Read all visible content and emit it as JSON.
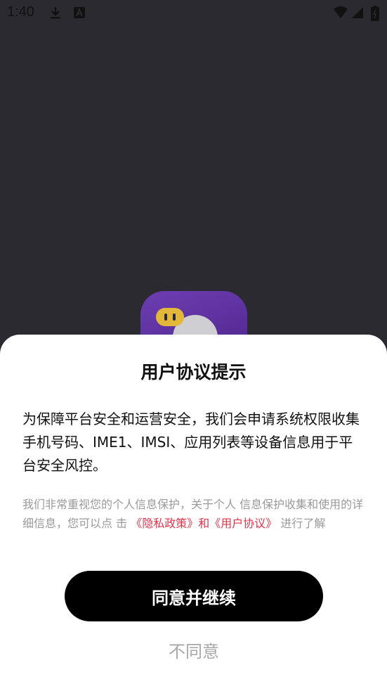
{
  "status_bar": {
    "time": "1:40",
    "icons": [
      "download-icon",
      "a-icon",
      "wifi-icon",
      "signal-icon",
      "battery-icon"
    ]
  },
  "dialog": {
    "title": "用户协议提示",
    "body": "为保障平台安全和运营安全，我们会申请系统权限收集手机号码、IME1、IMSI、应用列表等设备信息用于平台安全风控。",
    "note_prefix": "我们非常重视您的个人信息保护，关于个人 信息保护收集和使用的详细信息，您可以点 击",
    "privacy_link": "《隐私政策》",
    "and_text": "和",
    "terms_link": "《用户协议》",
    "note_suffix": "进行了解",
    "agree_label": "同意并继续",
    "disagree_label": "不同意"
  },
  "colors": {
    "backdrop": "#2b2a31",
    "link": "#e2334a",
    "primary_button": "#000000",
    "muted_text": "#9a9a9a"
  }
}
